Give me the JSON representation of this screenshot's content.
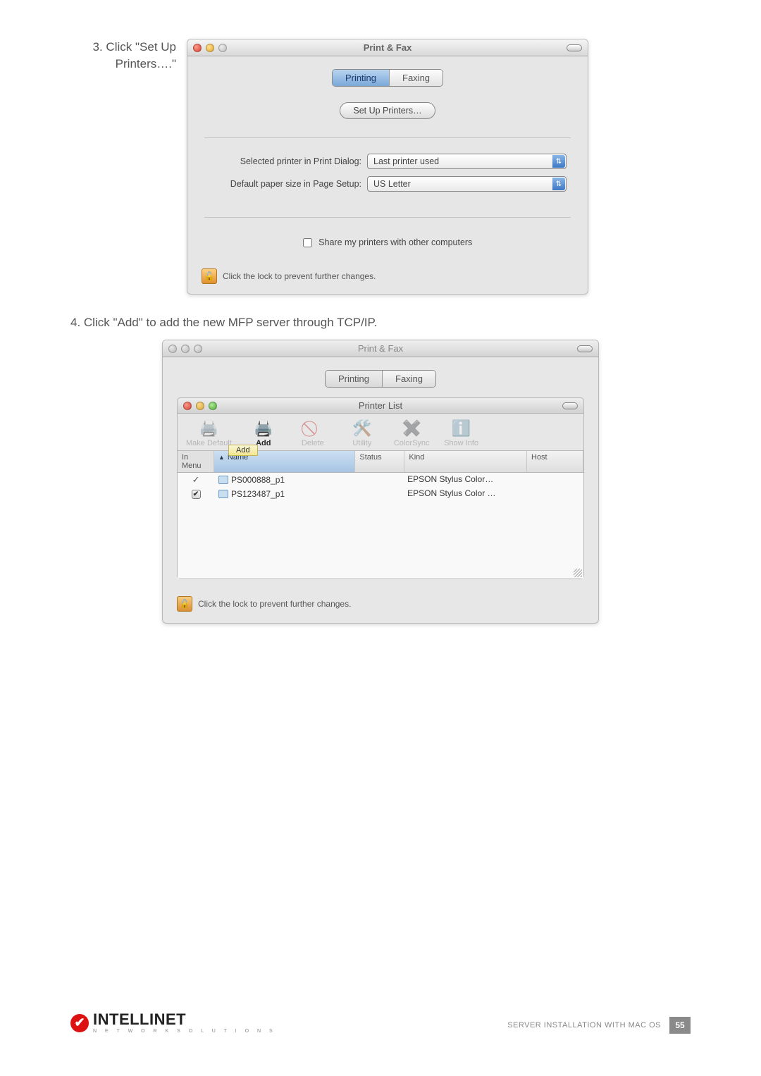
{
  "step3": {
    "label_line1": "3. Click \"Set Up",
    "label_line2": "Printers….\""
  },
  "step4": {
    "label": "4. Click \"Add\" to add the new MFP server through TCP/IP."
  },
  "window1": {
    "title": "Print & Fax",
    "tabs": {
      "printing": "Printing",
      "faxing": "Faxing"
    },
    "setup_button": "Set Up Printers…",
    "selected_label": "Selected printer in Print Dialog:",
    "selected_value": "Last printer used",
    "paper_label": "Default paper size in Page Setup:",
    "paper_value": "US Letter",
    "share_label": "Share my printers with other computers",
    "lock_text": "Click the lock to prevent further changes."
  },
  "window2": {
    "title": "Print & Fax",
    "tabs": {
      "printing": "Printing",
      "faxing": "Faxing"
    },
    "printer_list_title": "Printer List",
    "toolbar": {
      "make_default": "Make Default",
      "add": "Add",
      "delete": "Delete",
      "utility": "Utility",
      "colorsync": "ColorSync",
      "show_info": "Show Info"
    },
    "tooltip": "Add",
    "columns": {
      "in_menu": "In Menu",
      "name": "Name",
      "status": "Status",
      "kind": "Kind",
      "host": "Host"
    },
    "rows": [
      {
        "checked": "✓",
        "name": "PS000888_p1",
        "kind": "EPSON Stylus Color…",
        "boxed": false
      },
      {
        "checked": "✔",
        "name": "PS123487_p1",
        "kind": "EPSON Stylus Color …",
        "boxed": true
      }
    ],
    "lock_text": "Click the lock to prevent further changes."
  },
  "footer": {
    "brand": "INTELLINET",
    "subbrand": "N E T W O R K   S O L U T I O N S",
    "section": "SERVER INSTALLATION WITH MAC OS",
    "page": "55"
  }
}
